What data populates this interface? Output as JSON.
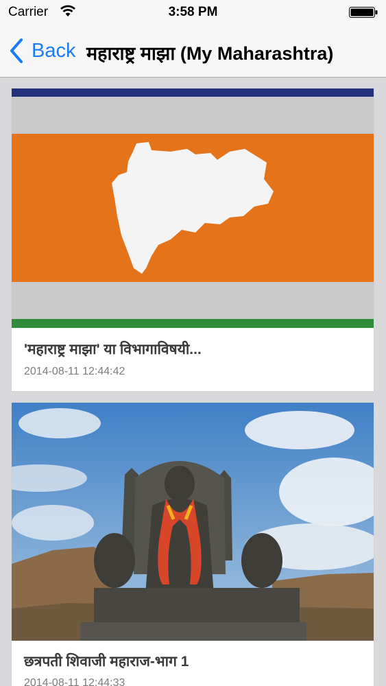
{
  "status_bar": {
    "carrier": "Carrier",
    "time": "3:58 PM",
    "icons": [
      "wifi-icon",
      "battery-icon"
    ]
  },
  "nav_bar": {
    "back_label": "Back",
    "title": "महाराष्ट्र माझा (My Maharashtra)",
    "accent_color": "#1a7cf5"
  },
  "feed": {
    "articles": [
      {
        "image": "maharashtra-flag-image",
        "title": "'महाराष्ट्र माझा' या विभागाविषयी...",
        "date": "2014-08-11 12:44:42"
      },
      {
        "image": "shivaji-statue-image",
        "title": "छत्रपती शिवाजी महाराज-भाग 1",
        "date": "2014-08-11 12:44:33"
      }
    ]
  }
}
